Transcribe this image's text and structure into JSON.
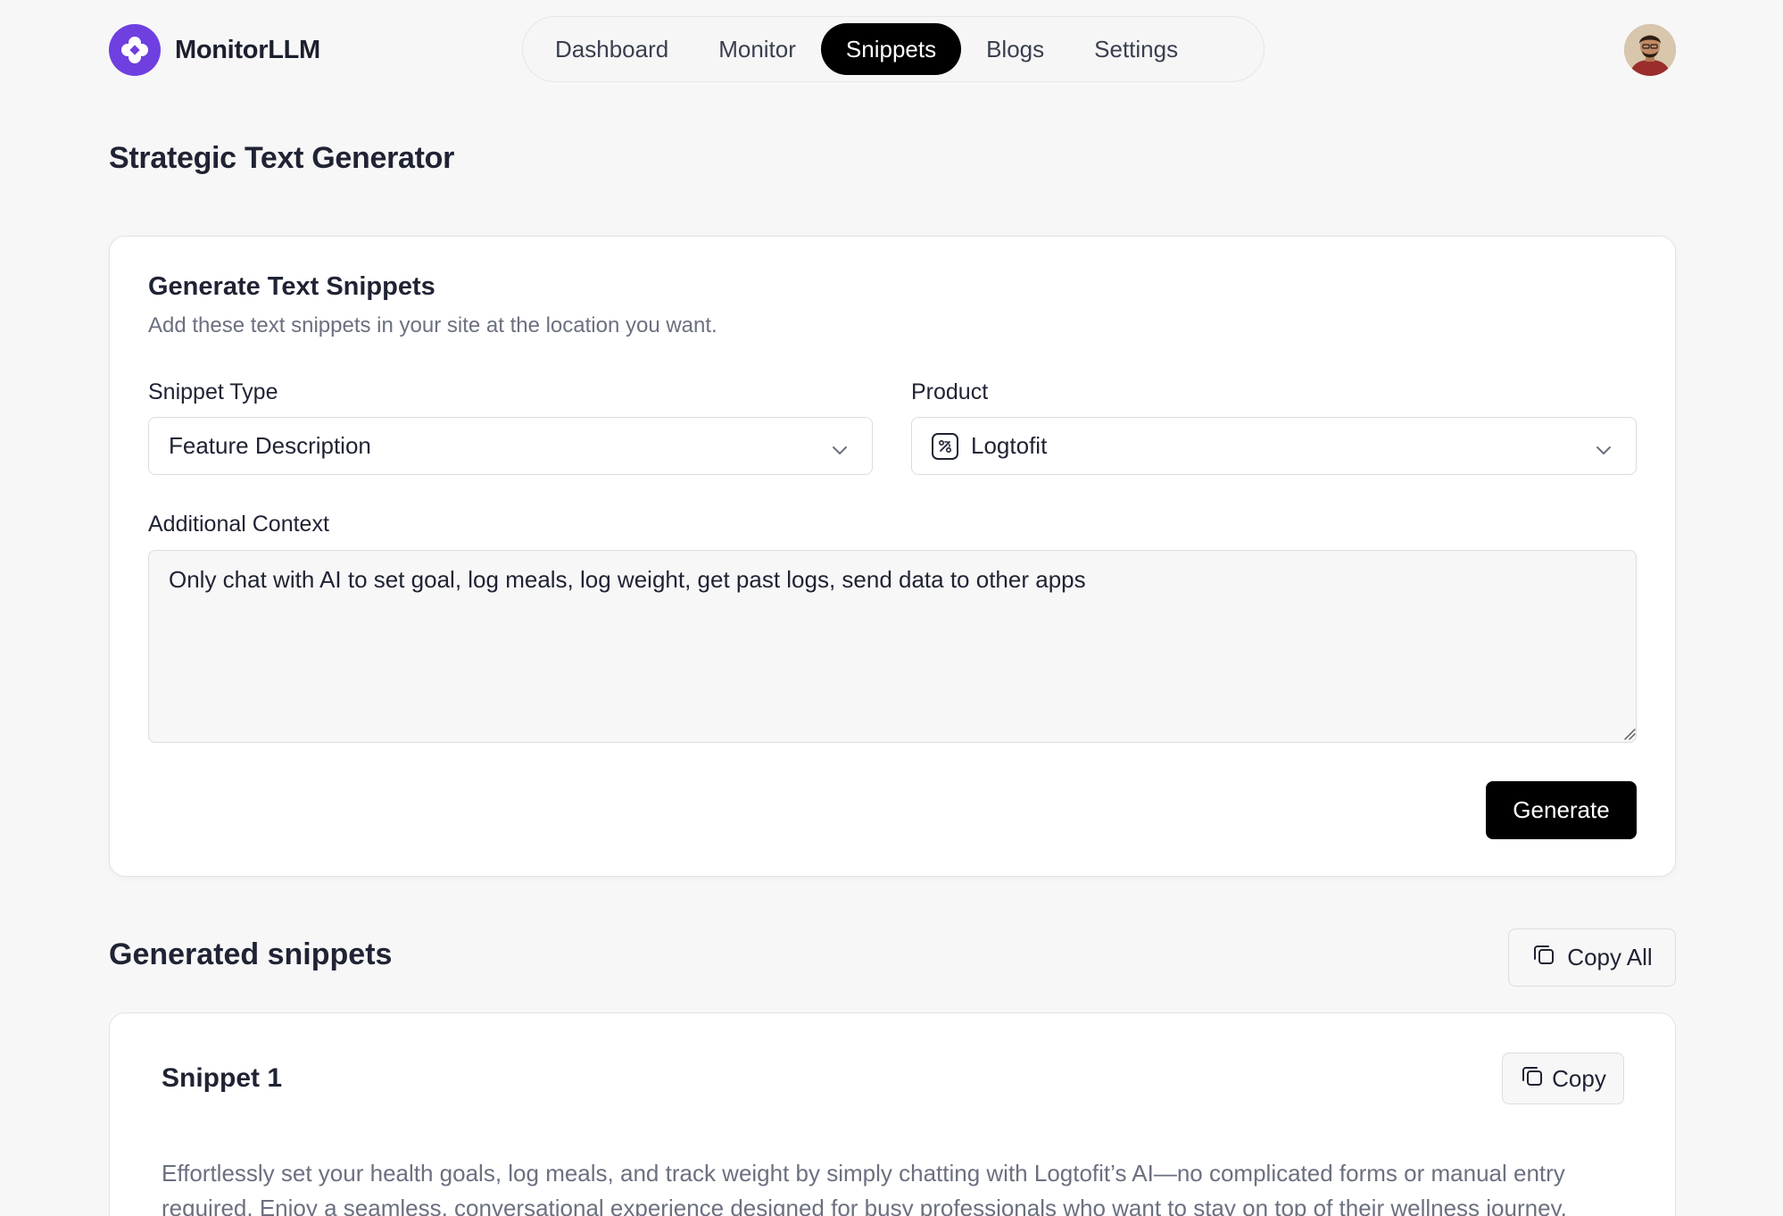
{
  "brand": {
    "name": "MonitorLLM",
    "logo_icon": "clover-icon",
    "logo_color": "#6f3fe0"
  },
  "nav": {
    "items": [
      {
        "label": "Dashboard",
        "active": false
      },
      {
        "label": "Monitor",
        "active": false
      },
      {
        "label": "Snippets",
        "active": true
      },
      {
        "label": "Blogs",
        "active": false
      },
      {
        "label": "Settings",
        "active": false
      }
    ]
  },
  "page": {
    "title": "Strategic Text Generator"
  },
  "generator": {
    "title": "Generate Text Snippets",
    "subtitle": "Add these text snippets in your site at the location you want.",
    "snippet_type": {
      "label": "Snippet Type",
      "value": "Feature Description"
    },
    "product": {
      "label": "Product",
      "value": "Logtofit"
    },
    "context": {
      "label": "Additional Context",
      "value": "Only chat with AI to set goal, log meals, log weight, get past logs, send data to other apps"
    },
    "generate_label": "Generate"
  },
  "results": {
    "title": "Generated snippets",
    "copy_all_label": "Copy All",
    "snippets": [
      {
        "title": "Snippet 1",
        "copy_label": "Copy",
        "text": "Effortlessly set your health goals, log meals, and track weight by simply chatting with Logtofit’s AI—no complicated forms or manual entry required. Enjoy a seamless, conversational experience designed for busy professionals who want to stay on top of their wellness journey."
      }
    ]
  },
  "colors": {
    "accent": "#000000",
    "background": "#f7f7f7",
    "muted_text": "#6b7080"
  }
}
